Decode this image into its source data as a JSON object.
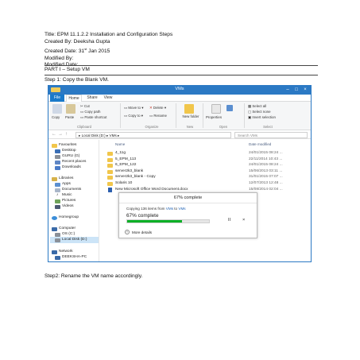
{
  "header": {
    "title": "Title: EPM 11.1.2.2 Installation and Configuration Steps",
    "created_by": "Created By: Deeksha Gupta",
    "created_date": "Created Date: 31",
    "created_date_sup": "st",
    "created_date_rest": " Jan 2015",
    "modified_by": "Modified By:",
    "modified_date": "Modified Date:"
  },
  "part_heading": "PART I – Setup VM",
  "step1": "Step 1: Copy the Blank VM.",
  "step2": "Step2: Rename the VM name accordingly.",
  "window": {
    "title": "VMs",
    "tabs": [
      "File",
      "Home",
      "Share",
      "View"
    ],
    "ribbon": {
      "copy": "Copy",
      "paste": "Paste",
      "cut": "Cut",
      "copy_path": "Copy path",
      "paste_shortcut": "Paste shortcut",
      "move_to": "Move to",
      "copy_to": "Copy to",
      "delete": "Delete",
      "rename": "Rename",
      "new_folder": "New folder",
      "properties": "Properties",
      "select_all": "Select all",
      "select_none": "Select none",
      "invert_selection": "Invert selection",
      "groups": [
        "Clipboard",
        "Organize",
        "New",
        "Open",
        "Select"
      ]
    },
    "address": "▸ Local Disk (D:) ▸ VMs ▸",
    "search_placeholder": "Search VMs",
    "nav": {
      "favourites": "Favourites",
      "desktop": "Desktop",
      "guru": "GURU (G)",
      "recent": "Recent places",
      "downloads": "Downloads",
      "libraries": "Libraries",
      "apps": "Apps",
      "documents": "Documents",
      "music": "Music",
      "pictures": "Pictures",
      "videos": "Videos",
      "homegroup": "Homegroup",
      "computer": "Computer",
      "os": "OS (C:)",
      "local_disk": "Local Disk (D:)",
      "network": "Network",
      "pc": "DEEKSHA-PC"
    },
    "columns": {
      "name": "Name",
      "date": "Date modified"
    },
    "files": [
      {
        "name": "4_11g",
        "date": "24/01/2015 08:24 ...",
        "type": "folder"
      },
      {
        "name": "5_EPM_113",
        "date": "22/11/2014 10:43 ...",
        "type": "folder"
      },
      {
        "name": "6_EPM_122",
        "date": "24/01/2015 08:24 ...",
        "type": "folder"
      },
      {
        "name": "server2k3_blank",
        "date": "15/06/2013 03:11 ...",
        "type": "folder"
      },
      {
        "name": "server2k3_blank - Copy",
        "date": "31/01/2015 07:07 ...",
        "type": "folder"
      },
      {
        "name": "Solaris 10",
        "date": "12/07/2013 12:48 ...",
        "type": "folder"
      },
      {
        "name": "New Microsoft Office Word Document.docx",
        "date": "15/08/2014 02:04 ...",
        "type": "doc"
      }
    ]
  },
  "dialog": {
    "title": "67% complete",
    "line_prefix": "Copying 136 items from ",
    "from": "VMs",
    "mid": " to ",
    "to": "VMs",
    "percent_text": "67% complete",
    "progress": 0.67,
    "pause": "II",
    "cancel": "×",
    "more_details": "More details",
    "bar_color": "#06b025"
  }
}
